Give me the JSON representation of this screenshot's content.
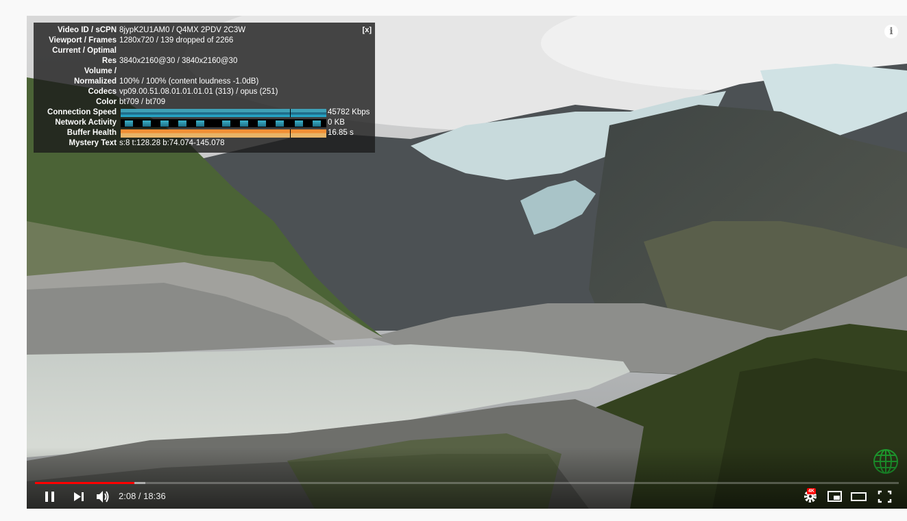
{
  "stats": {
    "close_label": "[x]",
    "rows": [
      {
        "label": "Video ID / sCPN",
        "value": "8jypK2U1AM0 / Q4MX 2PDV 2C3W"
      },
      {
        "label": "Viewport / Frames",
        "value": "1280x720 / 139 dropped of 2266"
      },
      {
        "label": "Current / Optimal",
        "value": ""
      },
      {
        "label": "Res",
        "value": "3840x2160@30 / 3840x2160@30"
      },
      {
        "label": "Volume /",
        "value": ""
      },
      {
        "label": "Normalized",
        "value": "100% / 100% (content loudness -1.0dB)"
      },
      {
        "label": "Codecs",
        "value": "vp09.00.51.08.01.01.01.01 (313) / opus (251)"
      },
      {
        "label": "Color",
        "value": "bt709 / bt709"
      },
      {
        "label": "Connection Speed",
        "value": "45782 Kbps"
      },
      {
        "label": "Network Activity",
        "value": "0 KB"
      },
      {
        "label": "Buffer Health",
        "value": "16.85 s"
      },
      {
        "label": "Mystery Text",
        "value": "s:8 t:128.28 b:74.074-145.078"
      }
    ]
  },
  "player": {
    "time_display": "2:08 / 18:36",
    "progress_fraction": 0.115,
    "buffered_fraction": 0.128,
    "settings_badge": "4K",
    "colors": {
      "progress": "#ff0000",
      "overlay_bg": "#1c1c1c"
    }
  },
  "icons": {
    "info": "i",
    "play_pause": "pause-icon",
    "next": "next-icon",
    "volume": "volume-icon",
    "settings": "gear-icon",
    "miniplayer": "miniplayer-icon",
    "theater": "theater-icon",
    "fullscreen": "fullscreen-icon",
    "globe": "globe-icon"
  }
}
